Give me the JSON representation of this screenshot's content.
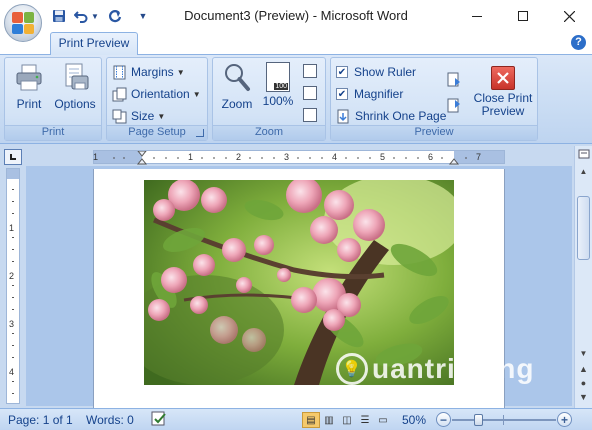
{
  "window": {
    "title": "Document3 (Preview) - Microsoft Word",
    "minimize_icon": "minimize-icon",
    "maximize_icon": "maximize-icon",
    "close_icon": "close-icon"
  },
  "quick_access": {
    "save_icon": "save-icon",
    "undo_icon": "undo-icon",
    "redo_icon": "redo-icon",
    "customize_icon": "customize-qat-icon"
  },
  "tabs": [
    {
      "label": "Print Preview",
      "active": true
    }
  ],
  "ribbon": {
    "print_group": {
      "label": "Print",
      "print_button": "Print",
      "options_button": "Options"
    },
    "page_setup_group": {
      "label": "Page Setup",
      "margins": "Margins",
      "orientation": "Orientation",
      "size": "Size"
    },
    "zoom_group": {
      "label": "Zoom",
      "zoom_button": "Zoom",
      "hundred_button": "100%",
      "hundred_icon_text": "100"
    },
    "preview_group": {
      "label": "Preview",
      "show_ruler": {
        "label": "Show Ruler",
        "checked": true
      },
      "magnifier": {
        "label": "Magnifier",
        "checked": true
      },
      "shrink_one_page": "Shrink One Page",
      "close_print_preview": "Close Print Preview"
    }
  },
  "ruler": {
    "ticks": [
      "1",
      "1",
      "2",
      "3",
      "4",
      "5",
      "6",
      "7"
    ]
  },
  "document": {
    "image": "cherry-blossom-photo",
    "watermark": "uantrimang"
  },
  "status": {
    "page": "Page: 1 of 1",
    "words": "Words: 0",
    "zoom": "50%",
    "zoom_minus": "−",
    "zoom_plus": "+",
    "zoom_fraction": 0.5
  },
  "colors": {
    "ribbon_text": "#15428b",
    "close_red": "#d9453b",
    "ribbon_bg": "#d3e3f6"
  }
}
